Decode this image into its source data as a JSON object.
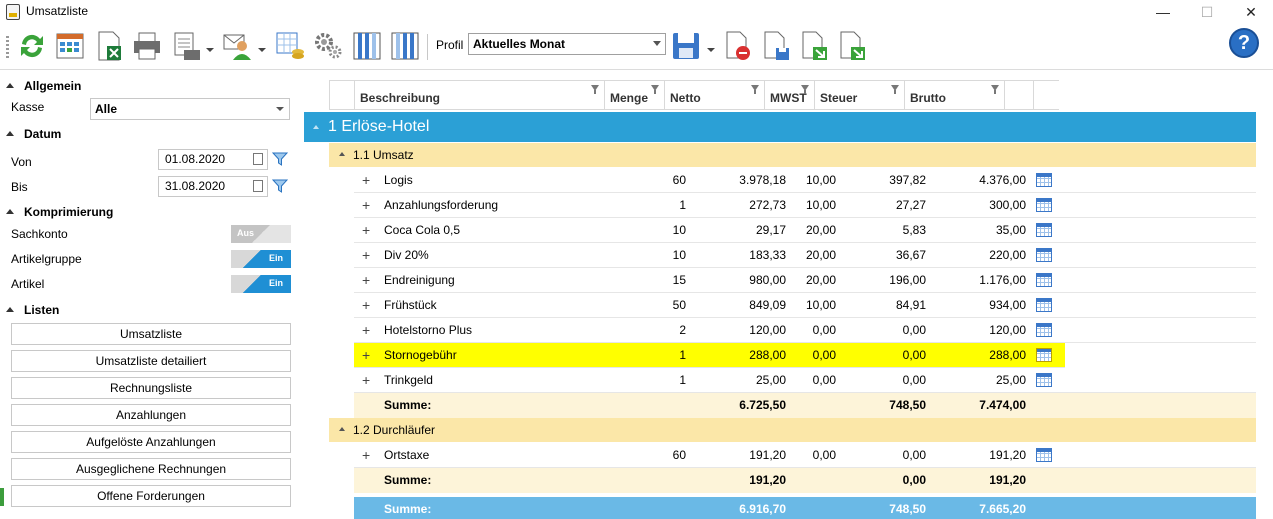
{
  "window": {
    "title": "Umsatzliste",
    "minimize": "—",
    "maximize": "☐",
    "close": "✕"
  },
  "toolbar": {
    "profil_label": "Profil",
    "profil_value": "Aktuelles Monat",
    "help_label": "?",
    "icons": [
      "refresh-icon",
      "calendar-grid-icon",
      "excel-export-icon",
      "print-icon",
      "print-preview-icon",
      "user-mail-icon",
      "table-coins-icon",
      "settings-gears-icon",
      "columns-icon",
      "columns-alt-icon",
      "save-icon",
      "delete-doc-icon",
      "save-doc-icon",
      "export-green-icon",
      "export-green-alt-icon",
      "help-icon"
    ]
  },
  "sidebar": {
    "allgemein": {
      "title": "Allgemein",
      "kasse_label": "Kasse",
      "kasse_value": "Alle"
    },
    "datum": {
      "title": "Datum",
      "von_label": "Von",
      "von_value": "01.08.2020",
      "bis_label": "Bis",
      "bis_value": "31.08.2020"
    },
    "komprimierung": {
      "title": "Komprimierung",
      "items": [
        {
          "label": "Sachkonto",
          "state": "Aus"
        },
        {
          "label": "Artikelgruppe",
          "state": "Ein"
        },
        {
          "label": "Artikel",
          "state": "Ein"
        }
      ]
    },
    "listen": {
      "title": "Listen",
      "buttons": [
        "Umsatzliste",
        "Umsatzliste detailiert",
        "Rechnungsliste",
        "Anzahlungen",
        "Aufgelöste Anzahlungen",
        "Ausgeglichene Rechnungen",
        "Offene Forderungen"
      ]
    }
  },
  "grid": {
    "columns": [
      "Beschreibung",
      "Menge",
      "Netto",
      "MWST",
      "Steuer",
      "Brutto"
    ],
    "group": "1 Erlöse-Hotel",
    "sub1": {
      "title": "1.1 Umsatz",
      "rows": [
        [
          "Logis",
          "60",
          "3.978,18",
          "10,00",
          "397,82",
          "4.376,00"
        ],
        [
          "Anzahlungsforderung",
          "1",
          "272,73",
          "10,00",
          "27,27",
          "300,00"
        ],
        [
          "Coca Cola 0,5",
          "10",
          "29,17",
          "20,00",
          "5,83",
          "35,00"
        ],
        [
          "Div 20%",
          "10",
          "183,33",
          "20,00",
          "36,67",
          "220,00"
        ],
        [
          "Endreinigung",
          "15",
          "980,00",
          "20,00",
          "196,00",
          "1.176,00"
        ],
        [
          "Frühstück",
          "50",
          "849,09",
          "10,00",
          "84,91",
          "934,00"
        ],
        [
          "Hotelstorno Plus",
          "2",
          "120,00",
          "0,00",
          "0,00",
          "120,00"
        ],
        [
          "Stornogebühr",
          "1",
          "288,00",
          "0,00",
          "0,00",
          "288,00"
        ],
        [
          "Trinkgeld",
          "1",
          "25,00",
          "0,00",
          "0,00",
          "25,00"
        ]
      ],
      "sum": {
        "label": "Summe:",
        "netto": "6.725,50",
        "steuer": "748,50",
        "brutto": "7.474,00"
      }
    },
    "sub2": {
      "title": "1.2 Durchläufer",
      "rows": [
        [
          "Ortstaxe",
          "60",
          "191,20",
          "0,00",
          "0,00",
          "191,20"
        ]
      ],
      "sum": {
        "label": "Summe:",
        "netto": "191,20",
        "steuer": "0,00",
        "brutto": "191,20"
      }
    },
    "total": {
      "label": "Summe:",
      "netto": "6.916,70",
      "steuer": "748,50",
      "brutto": "7.665,20"
    },
    "highlight_color": "#ffff00",
    "group_color": "#2ba0d6"
  }
}
